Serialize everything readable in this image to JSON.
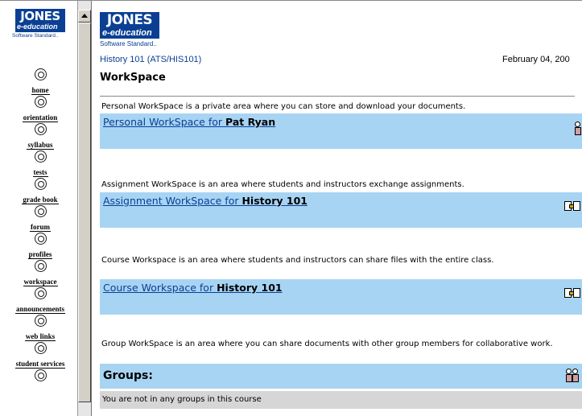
{
  "brand": {
    "name": "JONES",
    "sub": "e-education",
    "tagline": "Software Standard.."
  },
  "nav": {
    "items": [
      {
        "label": "home",
        "icon": "home-icon"
      },
      {
        "label": "orientation",
        "icon": "orientation-icon"
      },
      {
        "label": "syllabus",
        "icon": "syllabus-icon"
      },
      {
        "label": "tests",
        "icon": "tests-icon"
      },
      {
        "label": "grade book",
        "icon": "grade-book-icon"
      },
      {
        "label": "forum",
        "icon": "forum-icon"
      },
      {
        "label": "profiles",
        "icon": "profiles-icon"
      },
      {
        "label": "workspace",
        "icon": "workspace-icon"
      },
      {
        "label": "announcements",
        "icon": "announcements-icon"
      },
      {
        "label": "web links",
        "icon": "web-links-icon"
      },
      {
        "label": "student services",
        "icon": "student-services-icon"
      }
    ]
  },
  "header": {
    "course": "History 101 (ATS/HIS101)",
    "date": "February 04, 200",
    "title": "WorkSpace"
  },
  "sections": {
    "personal": {
      "desc": "Personal WorkSpace is a private area where you can store and download your documents.",
      "link_prefix": "Personal WorkSpace for ",
      "link_name": "Pat Ryan"
    },
    "assignment": {
      "desc": "Assignment WorkSpace is an area where students and instructors exchange assignments.",
      "link_prefix": "Assignment WorkSpace for ",
      "link_name": "History 101"
    },
    "course": {
      "desc": "Course Workspace is an area where students and instructors can share files with the entire class.",
      "link_prefix": "Course Workspace for ",
      "link_name": "History 101"
    },
    "group": {
      "desc": "Group WorkSpace is an area where you can share documents with other group members for collaborative work.",
      "groups_title": "Groups:",
      "no_groups": "You are not in any groups in this course"
    }
  },
  "colors": {
    "band": "#a8d4f4",
    "brand": "#0a3f94",
    "empty_row": "#d6d6d6"
  }
}
